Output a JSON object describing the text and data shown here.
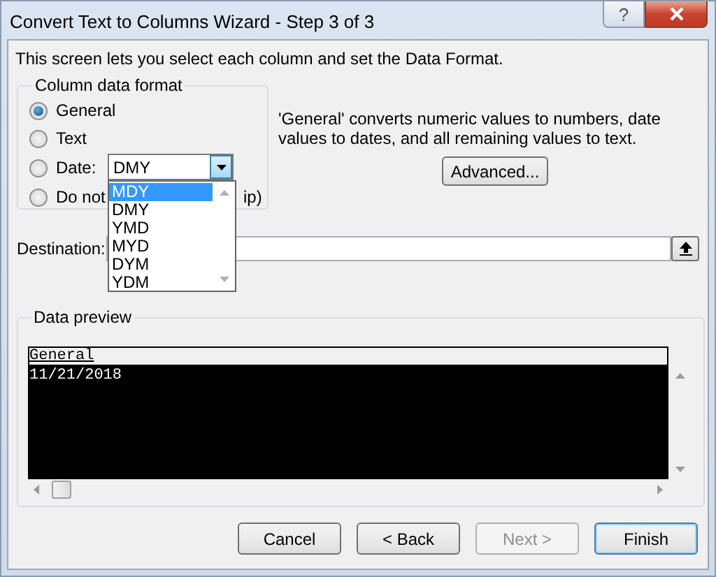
{
  "window": {
    "title": "Convert Text to Columns Wizard - Step 3 of 3",
    "help": "?"
  },
  "intro": "This screen lets you select each column and set the Data Format.",
  "column_data_format": {
    "title": "Column data format",
    "options": [
      {
        "label": "General",
        "selected": true
      },
      {
        "label": "Text",
        "selected": false
      },
      {
        "label": "Date:",
        "selected": false,
        "dropdown": {
          "value": "DMY",
          "expanded": true,
          "items": [
            {
              "label": "MDY",
              "highlighted": true
            },
            {
              "label": "DMY",
              "highlighted": false
            },
            {
              "label": "YMD",
              "highlighted": false
            },
            {
              "label": "MYD",
              "highlighted": false
            },
            {
              "label": "DYM",
              "highlighted": false
            },
            {
              "label": "YDM",
              "highlighted": false
            }
          ]
        }
      },
      {
        "label": "Do not",
        "label_tail": "ip)",
        "selected": false
      }
    ]
  },
  "description": "'General' converts numeric values to numbers, date values to dates, and all remaining values to text.",
  "advanced_button": "Advanced...",
  "destination": {
    "label": "Destination:"
  },
  "data_preview": {
    "title": "Data preview",
    "header": "General",
    "rows": [
      "11/21/2018"
    ]
  },
  "buttons": [
    {
      "label": "Cancel",
      "disabled": false,
      "default": false
    },
    {
      "label": "< Back",
      "disabled": false,
      "default": false
    },
    {
      "label": "Next >",
      "disabled": true,
      "default": false
    },
    {
      "label": "Finish",
      "disabled": false,
      "default": true
    }
  ]
}
